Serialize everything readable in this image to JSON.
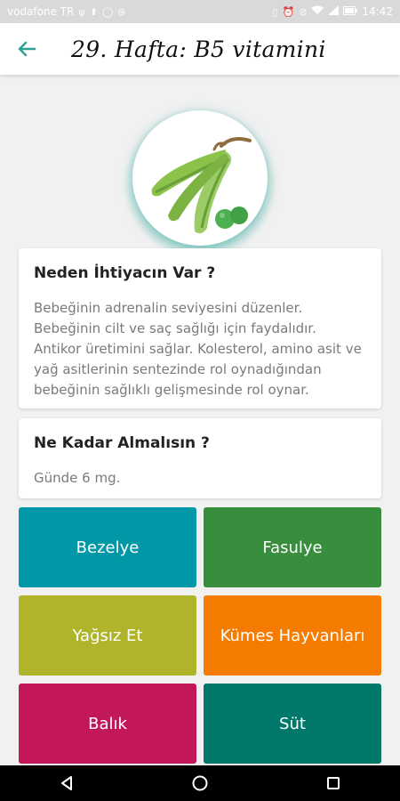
{
  "status_bar": {
    "carrier": "vodafone TR",
    "time": "14:42",
    "left_icons": [
      "usb-icon",
      "upload-icon",
      "whatsapp-icon",
      "gamepad-icon"
    ],
    "right_icons": [
      "vibrate-icon",
      "alarm-icon",
      "mute-icon",
      "wifi-icon",
      "signal-icon",
      "battery-icon"
    ]
  },
  "header": {
    "title": "29. Hafta: B5 vitamini"
  },
  "hero": {
    "icon": "peas-pod-icon",
    "accent_color": "#2aa198"
  },
  "need_card": {
    "title": "Neden İhtiyacın Var ?",
    "body": "Bebeğinin adrenalin seviyesini düzenler. Bebeğinin cilt ve saç sağlığı için faydalıdır. Antikor üretimini sağlar. Kolesterol, amino asit ve yağ asitlerinin sentezinde rol oynadığından bebeğinin sağlıklı gelişmesinde rol oynar."
  },
  "amount_card": {
    "title": "Ne Kadar Almalısın ?",
    "body": "Günde 6 mg."
  },
  "food_tiles": [
    {
      "label": "Bezelye",
      "color": "#0097a7"
    },
    {
      "label": "Fasulye",
      "color": "#388e3c"
    },
    {
      "label": "Yağsız Et",
      "color": "#afb42b"
    },
    {
      "label": "Kümes Hayvanları",
      "color": "#f57c00"
    },
    {
      "label": "Balık",
      "color": "#c2185b"
    },
    {
      "label": "Süt",
      "color": "#00796b"
    }
  ],
  "nav_bar": {
    "buttons": [
      "back-triangle-icon",
      "home-circle-icon",
      "recents-square-icon"
    ]
  }
}
